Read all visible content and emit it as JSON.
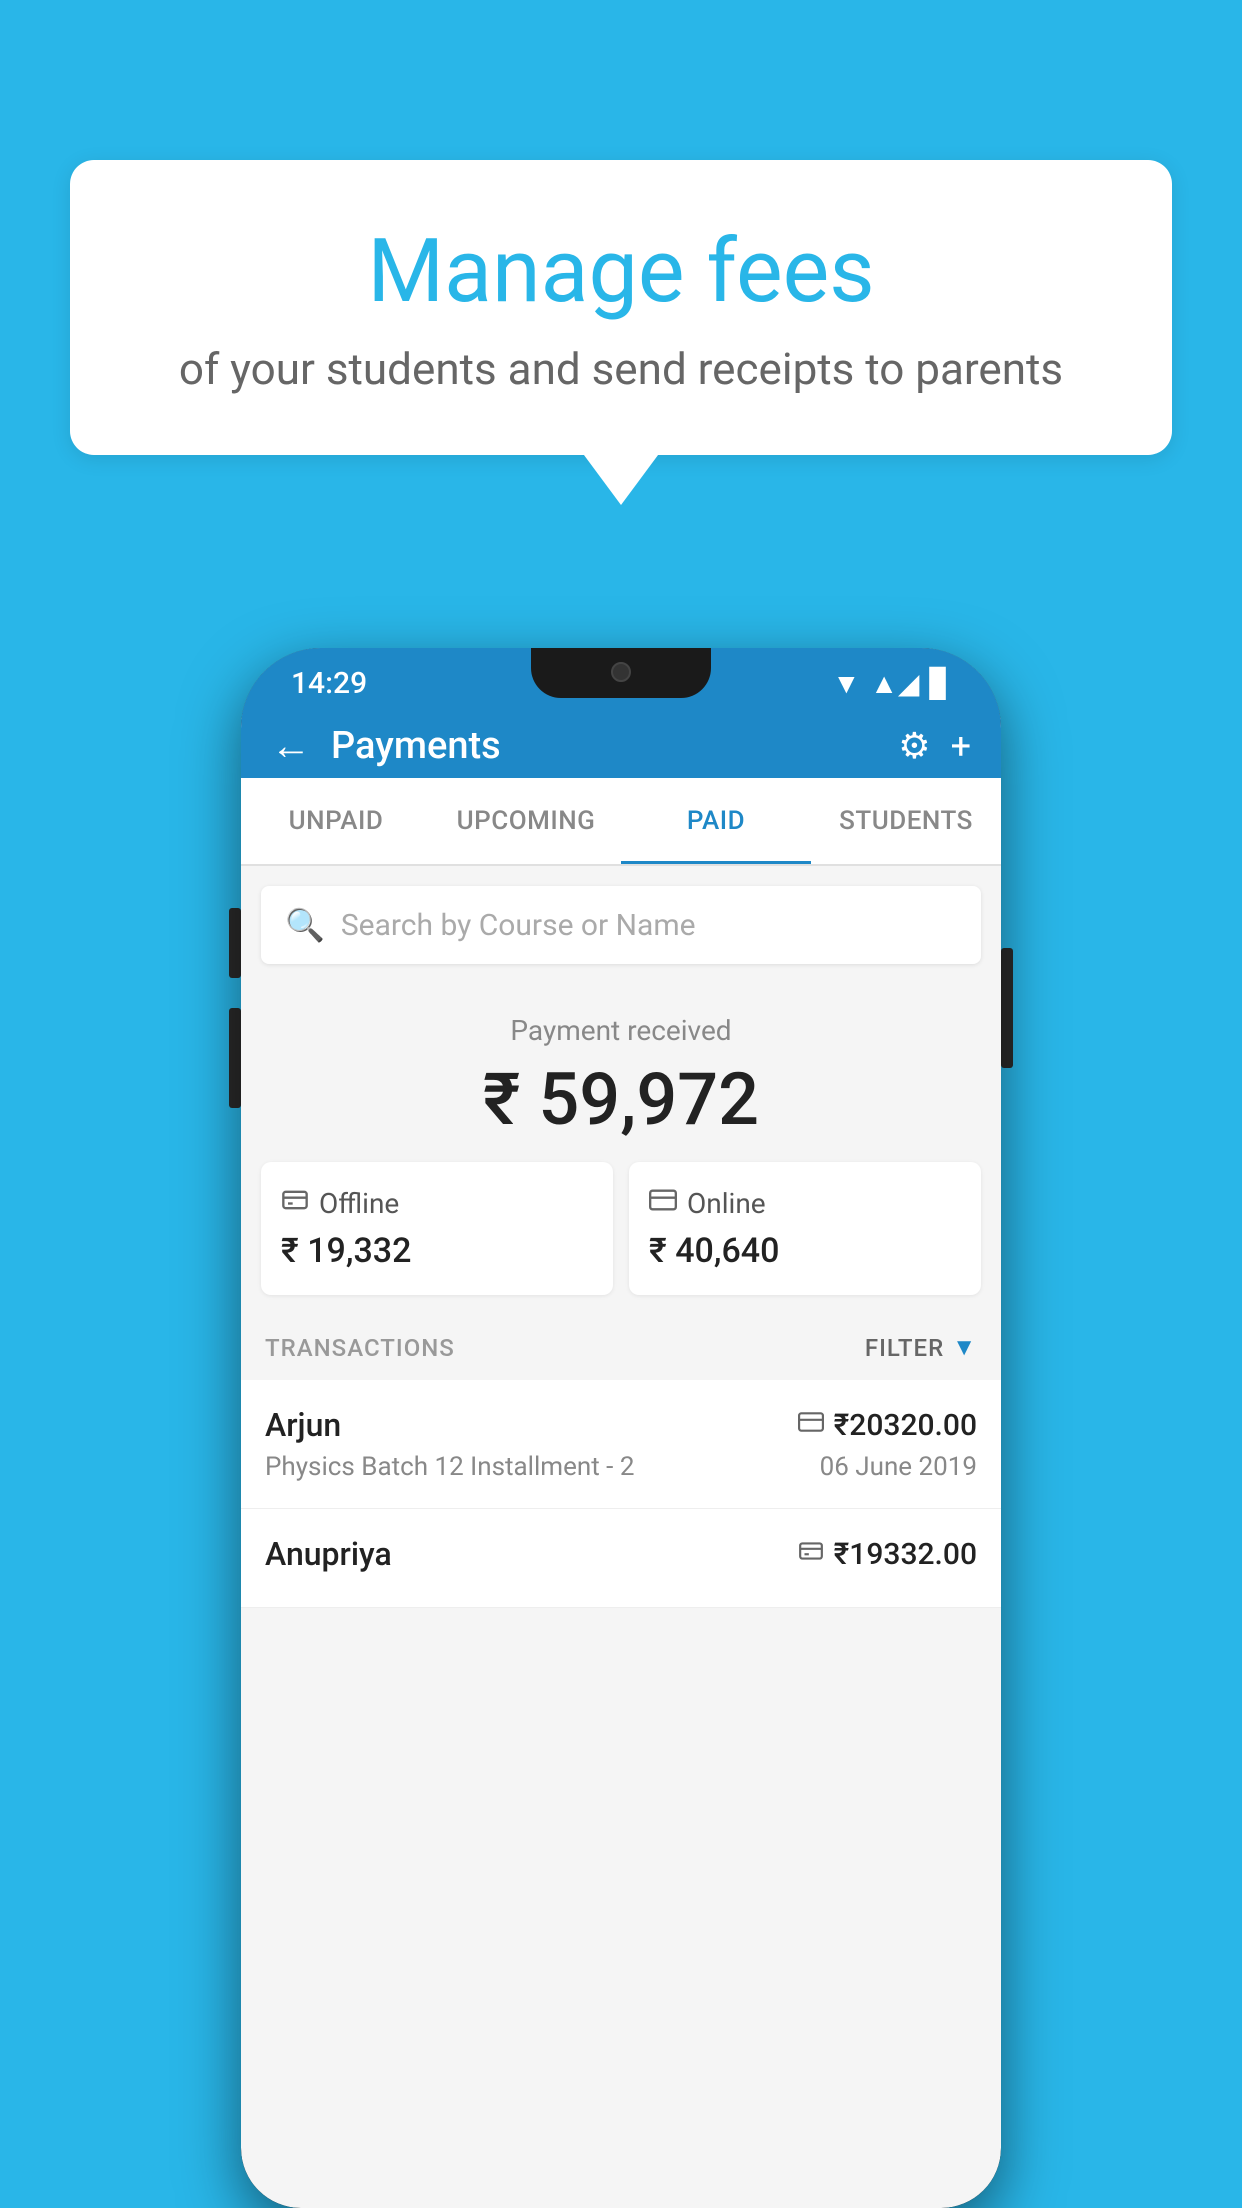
{
  "background": {
    "color": "#29B6E8"
  },
  "speech_bubble": {
    "title": "Manage fees",
    "subtitle": "of your students and send receipts to parents"
  },
  "status_bar": {
    "time": "14:29",
    "icons": [
      "wifi",
      "signal",
      "battery"
    ]
  },
  "top_bar": {
    "title": "Payments",
    "back_label": "←",
    "gear_label": "⚙",
    "plus_label": "+"
  },
  "tabs": [
    {
      "label": "UNPAID",
      "active": false
    },
    {
      "label": "UPCOMING",
      "active": false
    },
    {
      "label": "PAID",
      "active": true
    },
    {
      "label": "STUDENTS",
      "active": false
    }
  ],
  "search": {
    "placeholder": "Search by Course or Name"
  },
  "payment_received": {
    "label": "Payment received",
    "amount": "₹ 59,972"
  },
  "payment_cards": [
    {
      "icon": "💳",
      "label": "Offline",
      "amount": "₹ 19,332"
    },
    {
      "icon": "💳",
      "label": "Online",
      "amount": "₹ 40,640"
    }
  ],
  "transactions_section": {
    "label": "TRANSACTIONS",
    "filter_label": "FILTER"
  },
  "transactions": [
    {
      "name": "Arjun",
      "amount_icon": "💳",
      "amount": "₹20320.00",
      "description": "Physics Batch 12 Installment - 2",
      "date": "06 June 2019"
    },
    {
      "name": "Anupriya",
      "amount_icon": "💳",
      "amount": "₹19332.00",
      "description": "",
      "date": ""
    }
  ]
}
